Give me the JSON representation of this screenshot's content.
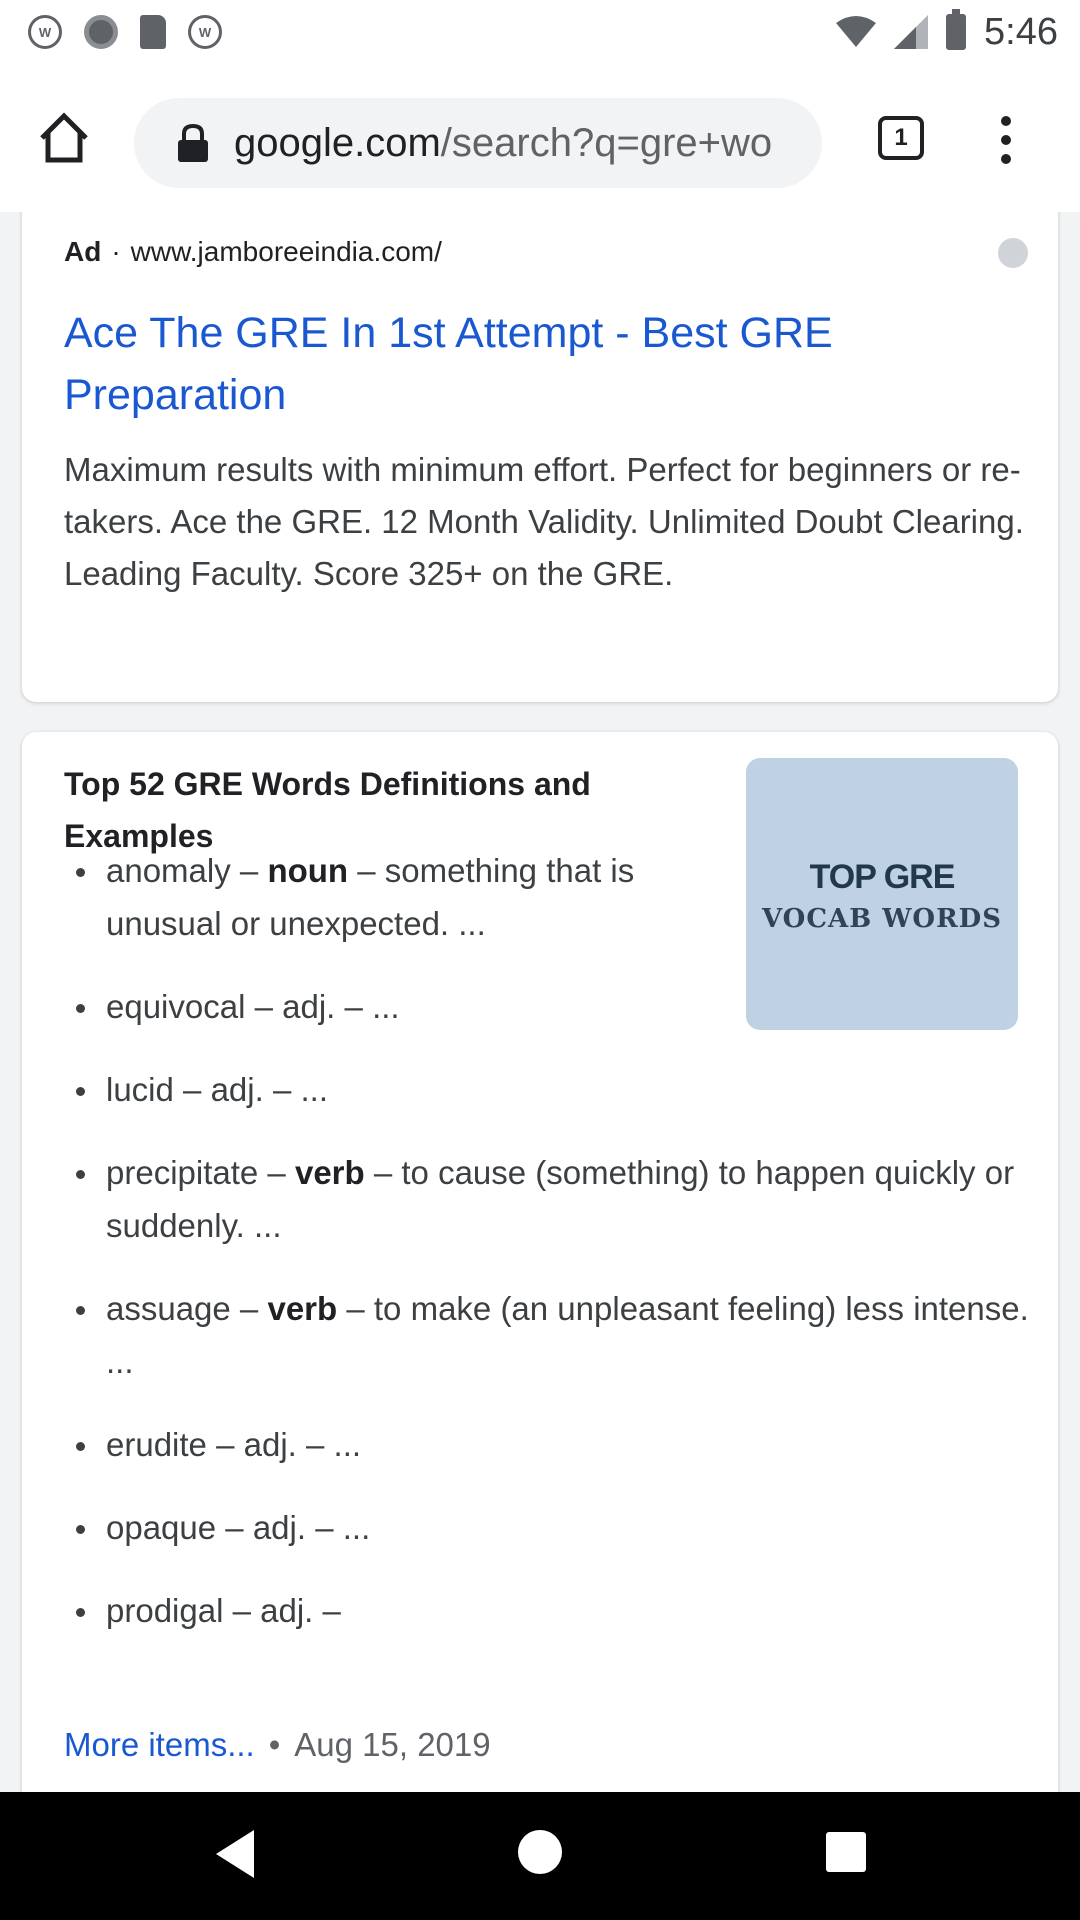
{
  "status_bar": {
    "time": "5:46",
    "left_icons": [
      "ubereats-notification-icon",
      "circle-notification-icon",
      "sd-card-icon",
      "ubereats-notification-icon"
    ],
    "left_icon_text": "W",
    "right_icons": [
      "wifi-icon",
      "cell-signal-icon",
      "battery-icon"
    ]
  },
  "browser": {
    "url_host": "google.com",
    "url_path": "/search?q=gre+wo",
    "tab_count": "1",
    "icons": [
      "home-icon",
      "lock-icon",
      "tabs-icon",
      "overflow-menu-icon"
    ]
  },
  "ad": {
    "label": "Ad",
    "separator": "·",
    "display_url": "www.jamboreeindia.com/",
    "title": "Ace The GRE In 1st Attempt - Best GRE Preparation",
    "description": "Maximum results with minimum effort. Perfect for beginners or re-takers. Ace the GRE. 12 Month Validity. Unlimited Doubt Clearing. Leading Faculty. Score 325+ on the GRE."
  },
  "result": {
    "title": "Top 52 GRE Words Definitions and Examples",
    "thumbnail": {
      "line1": "TOP GRE",
      "line2": "VOCAB WORDS",
      "bg_color": "#bfd2e3"
    },
    "items": [
      {
        "word": "anomaly",
        "pos": "noun",
        "pos_bold": true,
        "rest": "something that is unusual or unexpected. ..."
      },
      {
        "word": "equivocal",
        "pos": "adj.",
        "pos_bold": false,
        "rest": "..."
      },
      {
        "word": "lucid",
        "pos": "adj.",
        "pos_bold": false,
        "rest": "..."
      },
      {
        "word": "precipitate",
        "pos": "verb",
        "pos_bold": true,
        "rest": "to cause (something) to happen quickly or suddenly. ..."
      },
      {
        "word": "assuage",
        "pos": "verb",
        "pos_bold": true,
        "rest": "to make (an unpleasant feeling) less intense. ..."
      },
      {
        "word": "erudite",
        "pos": "adj.",
        "pos_bold": false,
        "rest": "..."
      },
      {
        "word": "opaque",
        "pos": "adj.",
        "pos_bold": false,
        "rest": "..."
      },
      {
        "word": "prodigal",
        "pos": "adj.",
        "pos_bold": false,
        "rest": ""
      }
    ],
    "more_items": "More items...",
    "date_separator": "•",
    "date": "Aug 15, 2019"
  },
  "nav_bar": {
    "icons": [
      "back-icon",
      "home-circle-icon",
      "recents-icon"
    ]
  },
  "colors": {
    "link_blue": "#1a58d2",
    "text_primary": "#202124",
    "text_secondary": "#3c4043",
    "page_bg": "#f1f3f4"
  }
}
